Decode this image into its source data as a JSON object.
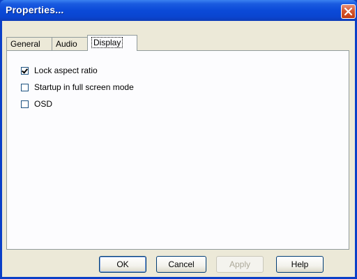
{
  "window": {
    "title": "Properties...",
    "colors": {
      "titlebar": "#0b4ad8",
      "close": "#d5562e",
      "face": "#ece9d8"
    }
  },
  "tabs": [
    {
      "label": "General",
      "active": false
    },
    {
      "label": "Audio",
      "active": false
    },
    {
      "label": "Display",
      "active": true
    }
  ],
  "options": [
    {
      "label": "Lock aspect ratio",
      "checked": true
    },
    {
      "label": "Startup in full screen mode",
      "checked": false
    },
    {
      "label": "OSD",
      "checked": false
    }
  ],
  "buttons": {
    "ok": "OK",
    "cancel": "Cancel",
    "apply": "Apply",
    "help": "Help"
  },
  "icons": {
    "close": "close-icon",
    "check": "checkmark-icon"
  }
}
